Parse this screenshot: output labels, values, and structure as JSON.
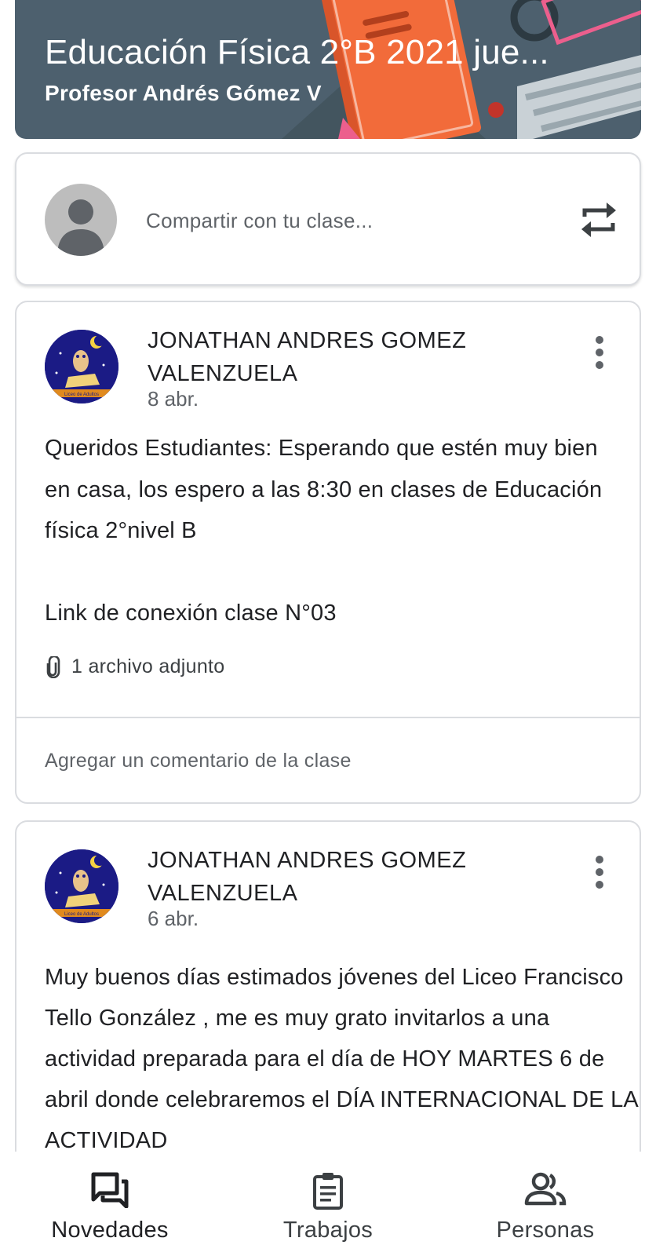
{
  "course": {
    "title": "Educación Física 2°B 2021  jue...",
    "teacher": "Profesor Andrés Gómez V"
  },
  "share": {
    "placeholder": "Compartir con tu clase..."
  },
  "posts": [
    {
      "author": "JONATHAN ANDRES GOMEZ VALENZUELA",
      "date": "8 abr.",
      "body": [
        "Queridos Estudiantes: Esperando que estén muy bien en casa, los espero a las 8:30 en clases de Educación física 2°nivel B",
        "Link de conexión clase N°03"
      ],
      "attachments": "1 archivo adjunto",
      "comment_prompt": "Agregar un comentario de la clase",
      "avatar_caption": "Liceo de Adultos"
    },
    {
      "author": "JONATHAN ANDRES GOMEZ VALENZUELA",
      "date": "6 abr.",
      "body": [
        "Muy buenos días estimados jóvenes del Liceo Francisco Tello González , me es muy grato invitarlos a una actividad preparada para el día de HOY MARTES 6 de abril donde celebraremos el DÍA INTERNACIONAL DE LA ACTIVIDAD"
      ],
      "avatar_caption": "Liceo de Adultos"
    }
  ],
  "bottom_nav": {
    "items": [
      {
        "label": "Novedades",
        "icon": "stream-icon",
        "active": true
      },
      {
        "label": "Trabajos",
        "icon": "classwork-icon",
        "active": false
      },
      {
        "label": "Personas",
        "icon": "people-icon",
        "active": false
      }
    ]
  },
  "colors": {
    "banner": "#4d606e",
    "book": "#f26b3a",
    "text": "#202124",
    "muted": "#5f6368"
  }
}
